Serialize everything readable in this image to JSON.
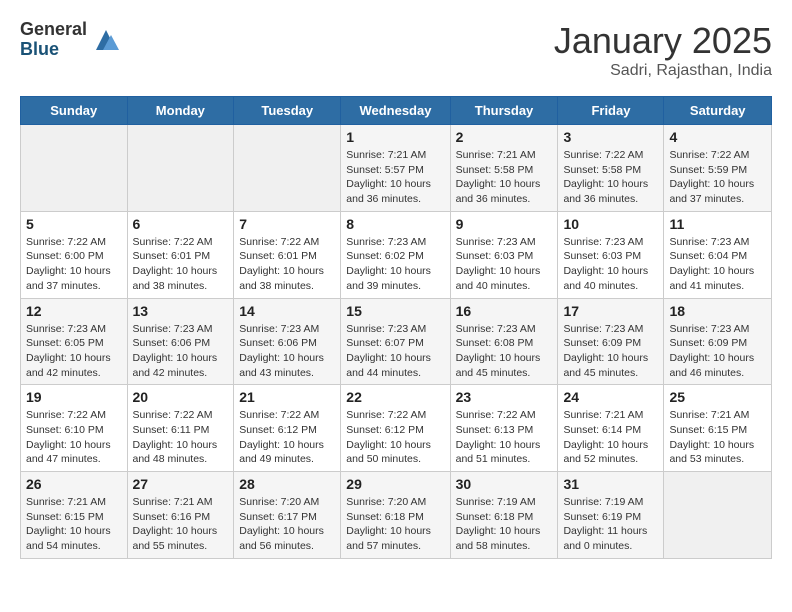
{
  "header": {
    "logo_general": "General",
    "logo_blue": "Blue",
    "month_title": "January 2025",
    "subtitle": "Sadri, Rajasthan, India"
  },
  "days_of_week": [
    "Sunday",
    "Monday",
    "Tuesday",
    "Wednesday",
    "Thursday",
    "Friday",
    "Saturday"
  ],
  "weeks": [
    [
      {
        "day": "",
        "info": ""
      },
      {
        "day": "",
        "info": ""
      },
      {
        "day": "",
        "info": ""
      },
      {
        "day": "1",
        "info": "Sunrise: 7:21 AM\nSunset: 5:57 PM\nDaylight: 10 hours\nand 36 minutes."
      },
      {
        "day": "2",
        "info": "Sunrise: 7:21 AM\nSunset: 5:58 PM\nDaylight: 10 hours\nand 36 minutes."
      },
      {
        "day": "3",
        "info": "Sunrise: 7:22 AM\nSunset: 5:58 PM\nDaylight: 10 hours\nand 36 minutes."
      },
      {
        "day": "4",
        "info": "Sunrise: 7:22 AM\nSunset: 5:59 PM\nDaylight: 10 hours\nand 37 minutes."
      }
    ],
    [
      {
        "day": "5",
        "info": "Sunrise: 7:22 AM\nSunset: 6:00 PM\nDaylight: 10 hours\nand 37 minutes."
      },
      {
        "day": "6",
        "info": "Sunrise: 7:22 AM\nSunset: 6:01 PM\nDaylight: 10 hours\nand 38 minutes."
      },
      {
        "day": "7",
        "info": "Sunrise: 7:22 AM\nSunset: 6:01 PM\nDaylight: 10 hours\nand 38 minutes."
      },
      {
        "day": "8",
        "info": "Sunrise: 7:23 AM\nSunset: 6:02 PM\nDaylight: 10 hours\nand 39 minutes."
      },
      {
        "day": "9",
        "info": "Sunrise: 7:23 AM\nSunset: 6:03 PM\nDaylight: 10 hours\nand 40 minutes."
      },
      {
        "day": "10",
        "info": "Sunrise: 7:23 AM\nSunset: 6:03 PM\nDaylight: 10 hours\nand 40 minutes."
      },
      {
        "day": "11",
        "info": "Sunrise: 7:23 AM\nSunset: 6:04 PM\nDaylight: 10 hours\nand 41 minutes."
      }
    ],
    [
      {
        "day": "12",
        "info": "Sunrise: 7:23 AM\nSunset: 6:05 PM\nDaylight: 10 hours\nand 42 minutes."
      },
      {
        "day": "13",
        "info": "Sunrise: 7:23 AM\nSunset: 6:06 PM\nDaylight: 10 hours\nand 42 minutes."
      },
      {
        "day": "14",
        "info": "Sunrise: 7:23 AM\nSunset: 6:06 PM\nDaylight: 10 hours\nand 43 minutes."
      },
      {
        "day": "15",
        "info": "Sunrise: 7:23 AM\nSunset: 6:07 PM\nDaylight: 10 hours\nand 44 minutes."
      },
      {
        "day": "16",
        "info": "Sunrise: 7:23 AM\nSunset: 6:08 PM\nDaylight: 10 hours\nand 45 minutes."
      },
      {
        "day": "17",
        "info": "Sunrise: 7:23 AM\nSunset: 6:09 PM\nDaylight: 10 hours\nand 45 minutes."
      },
      {
        "day": "18",
        "info": "Sunrise: 7:23 AM\nSunset: 6:09 PM\nDaylight: 10 hours\nand 46 minutes."
      }
    ],
    [
      {
        "day": "19",
        "info": "Sunrise: 7:22 AM\nSunset: 6:10 PM\nDaylight: 10 hours\nand 47 minutes."
      },
      {
        "day": "20",
        "info": "Sunrise: 7:22 AM\nSunset: 6:11 PM\nDaylight: 10 hours\nand 48 minutes."
      },
      {
        "day": "21",
        "info": "Sunrise: 7:22 AM\nSunset: 6:12 PM\nDaylight: 10 hours\nand 49 minutes."
      },
      {
        "day": "22",
        "info": "Sunrise: 7:22 AM\nSunset: 6:12 PM\nDaylight: 10 hours\nand 50 minutes."
      },
      {
        "day": "23",
        "info": "Sunrise: 7:22 AM\nSunset: 6:13 PM\nDaylight: 10 hours\nand 51 minutes."
      },
      {
        "day": "24",
        "info": "Sunrise: 7:21 AM\nSunset: 6:14 PM\nDaylight: 10 hours\nand 52 minutes."
      },
      {
        "day": "25",
        "info": "Sunrise: 7:21 AM\nSunset: 6:15 PM\nDaylight: 10 hours\nand 53 minutes."
      }
    ],
    [
      {
        "day": "26",
        "info": "Sunrise: 7:21 AM\nSunset: 6:15 PM\nDaylight: 10 hours\nand 54 minutes."
      },
      {
        "day": "27",
        "info": "Sunrise: 7:21 AM\nSunset: 6:16 PM\nDaylight: 10 hours\nand 55 minutes."
      },
      {
        "day": "28",
        "info": "Sunrise: 7:20 AM\nSunset: 6:17 PM\nDaylight: 10 hours\nand 56 minutes."
      },
      {
        "day": "29",
        "info": "Sunrise: 7:20 AM\nSunset: 6:18 PM\nDaylight: 10 hours\nand 57 minutes."
      },
      {
        "day": "30",
        "info": "Sunrise: 7:19 AM\nSunset: 6:18 PM\nDaylight: 10 hours\nand 58 minutes."
      },
      {
        "day": "31",
        "info": "Sunrise: 7:19 AM\nSunset: 6:19 PM\nDaylight: 11 hours\nand 0 minutes."
      },
      {
        "day": "",
        "info": ""
      }
    ]
  ]
}
